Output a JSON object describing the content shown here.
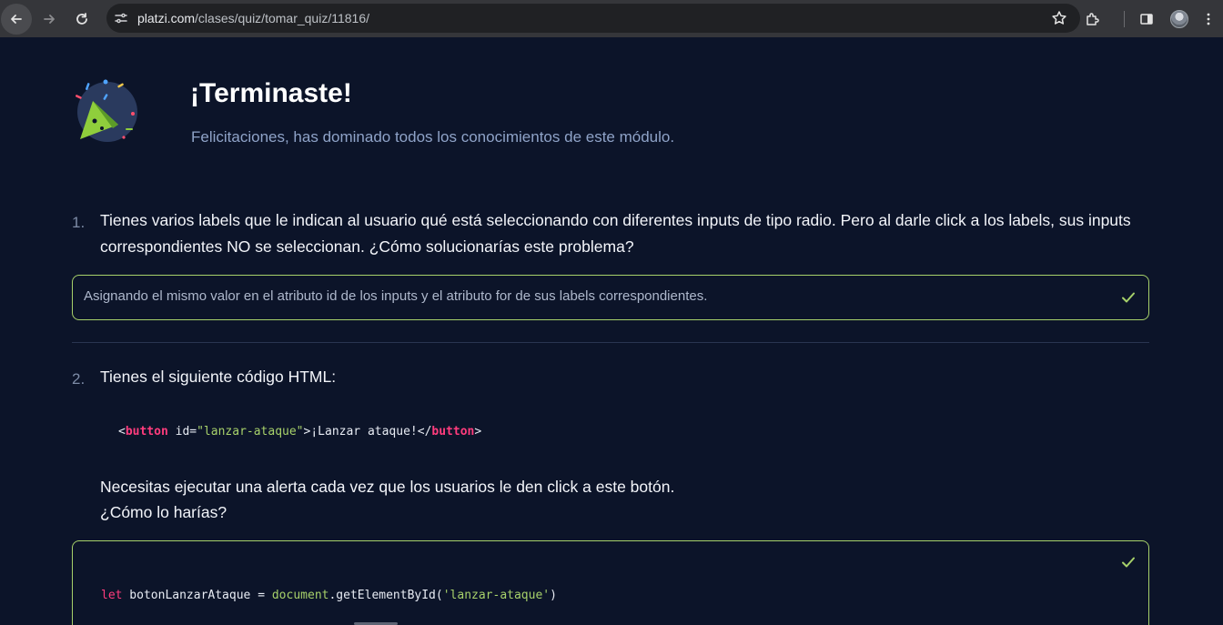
{
  "browser": {
    "url_host": "platzi.com",
    "url_path": "/clases/quiz/tomar_quiz/11816/"
  },
  "header": {
    "title": "¡Terminaste!",
    "subtitle": "Felicitaciones, has dominado todos los conocimientos de este módulo."
  },
  "questions": [
    {
      "number": "1.",
      "text": "Tienes varios labels que le indican al usuario qué está seleccionando con diferentes inputs de tipo radio. Pero al darle click a los labels, sus inputs correspondientes NO se seleccionan. ¿Cómo solucionarías este problema?",
      "answer": "Asignando el mismo valor en el atributo id de los inputs y el atributo for de sus labels correspondientes."
    },
    {
      "number": "2.",
      "text": "Tienes el siguiente código HTML:",
      "code": {
        "open_bracket": "<",
        "tag": "button",
        "attr": " id=",
        "value": "\"lanzar-ataque\"",
        "inner": ">¡Lanzar ataque!</",
        "close_tag": "button",
        "close_bracket": ">"
      },
      "followup_line1": "Necesitas ejecutar una alerta cada vez que los usuarios le den click a este botón.",
      "followup_line2": "¿Cómo lo harías?",
      "answer_code": {
        "keyword": "let",
        "var": " botonLanzarAtaque = ",
        "object": "document",
        "method": ".getElementById(",
        "arg": "'lanzar-ataque'",
        "close": ")"
      }
    }
  ],
  "colors": {
    "background": "#0c1429",
    "correct": "#a7d16a",
    "code_tag": "#ff3c7d"
  }
}
